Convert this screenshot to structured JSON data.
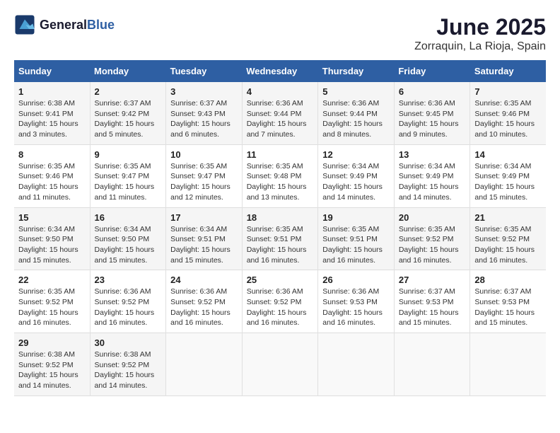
{
  "header": {
    "logo_general": "General",
    "logo_blue": "Blue",
    "title": "June 2025",
    "subtitle": "Zorraquin, La Rioja, Spain"
  },
  "columns": [
    "Sunday",
    "Monday",
    "Tuesday",
    "Wednesday",
    "Thursday",
    "Friday",
    "Saturday"
  ],
  "weeks": [
    [
      {
        "day": "1",
        "sunrise": "6:38 AM",
        "sunset": "9:41 PM",
        "daylight": "15 hours and 3 minutes."
      },
      {
        "day": "2",
        "sunrise": "6:37 AM",
        "sunset": "9:42 PM",
        "daylight": "15 hours and 5 minutes."
      },
      {
        "day": "3",
        "sunrise": "6:37 AM",
        "sunset": "9:43 PM",
        "daylight": "15 hours and 6 minutes."
      },
      {
        "day": "4",
        "sunrise": "6:36 AM",
        "sunset": "9:44 PM",
        "daylight": "15 hours and 7 minutes."
      },
      {
        "day": "5",
        "sunrise": "6:36 AM",
        "sunset": "9:44 PM",
        "daylight": "15 hours and 8 minutes."
      },
      {
        "day": "6",
        "sunrise": "6:36 AM",
        "sunset": "9:45 PM",
        "daylight": "15 hours and 9 minutes."
      },
      {
        "day": "7",
        "sunrise": "6:35 AM",
        "sunset": "9:46 PM",
        "daylight": "15 hours and 10 minutes."
      }
    ],
    [
      {
        "day": "8",
        "sunrise": "6:35 AM",
        "sunset": "9:46 PM",
        "daylight": "15 hours and 11 minutes."
      },
      {
        "day": "9",
        "sunrise": "6:35 AM",
        "sunset": "9:47 PM",
        "daylight": "15 hours and 11 minutes."
      },
      {
        "day": "10",
        "sunrise": "6:35 AM",
        "sunset": "9:47 PM",
        "daylight": "15 hours and 12 minutes."
      },
      {
        "day": "11",
        "sunrise": "6:35 AM",
        "sunset": "9:48 PM",
        "daylight": "15 hours and 13 minutes."
      },
      {
        "day": "12",
        "sunrise": "6:34 AM",
        "sunset": "9:49 PM",
        "daylight": "15 hours and 14 minutes."
      },
      {
        "day": "13",
        "sunrise": "6:34 AM",
        "sunset": "9:49 PM",
        "daylight": "15 hours and 14 minutes."
      },
      {
        "day": "14",
        "sunrise": "6:34 AM",
        "sunset": "9:49 PM",
        "daylight": "15 hours and 15 minutes."
      }
    ],
    [
      {
        "day": "15",
        "sunrise": "6:34 AM",
        "sunset": "9:50 PM",
        "daylight": "15 hours and 15 minutes."
      },
      {
        "day": "16",
        "sunrise": "6:34 AM",
        "sunset": "9:50 PM",
        "daylight": "15 hours and 15 minutes."
      },
      {
        "day": "17",
        "sunrise": "6:34 AM",
        "sunset": "9:51 PM",
        "daylight": "15 hours and 15 minutes."
      },
      {
        "day": "18",
        "sunrise": "6:35 AM",
        "sunset": "9:51 PM",
        "daylight": "15 hours and 16 minutes."
      },
      {
        "day": "19",
        "sunrise": "6:35 AM",
        "sunset": "9:51 PM",
        "daylight": "15 hours and 16 minutes."
      },
      {
        "day": "20",
        "sunrise": "6:35 AM",
        "sunset": "9:52 PM",
        "daylight": "15 hours and 16 minutes."
      },
      {
        "day": "21",
        "sunrise": "6:35 AM",
        "sunset": "9:52 PM",
        "daylight": "15 hours and 16 minutes."
      }
    ],
    [
      {
        "day": "22",
        "sunrise": "6:35 AM",
        "sunset": "9:52 PM",
        "daylight": "15 hours and 16 minutes."
      },
      {
        "day": "23",
        "sunrise": "6:36 AM",
        "sunset": "9:52 PM",
        "daylight": "15 hours and 16 minutes."
      },
      {
        "day": "24",
        "sunrise": "6:36 AM",
        "sunset": "9:52 PM",
        "daylight": "15 hours and 16 minutes."
      },
      {
        "day": "25",
        "sunrise": "6:36 AM",
        "sunset": "9:52 PM",
        "daylight": "15 hours and 16 minutes."
      },
      {
        "day": "26",
        "sunrise": "6:36 AM",
        "sunset": "9:53 PM",
        "daylight": "15 hours and 16 minutes."
      },
      {
        "day": "27",
        "sunrise": "6:37 AM",
        "sunset": "9:53 PM",
        "daylight": "15 hours and 15 minutes."
      },
      {
        "day": "28",
        "sunrise": "6:37 AM",
        "sunset": "9:53 PM",
        "daylight": "15 hours and 15 minutes."
      }
    ],
    [
      {
        "day": "29",
        "sunrise": "6:38 AM",
        "sunset": "9:52 PM",
        "daylight": "15 hours and 14 minutes."
      },
      {
        "day": "30",
        "sunrise": "6:38 AM",
        "sunset": "9:52 PM",
        "daylight": "15 hours and 14 minutes."
      },
      null,
      null,
      null,
      null,
      null
    ]
  ],
  "labels": {
    "sunrise": "Sunrise:",
    "sunset": "Sunset:",
    "daylight": "Daylight:"
  }
}
